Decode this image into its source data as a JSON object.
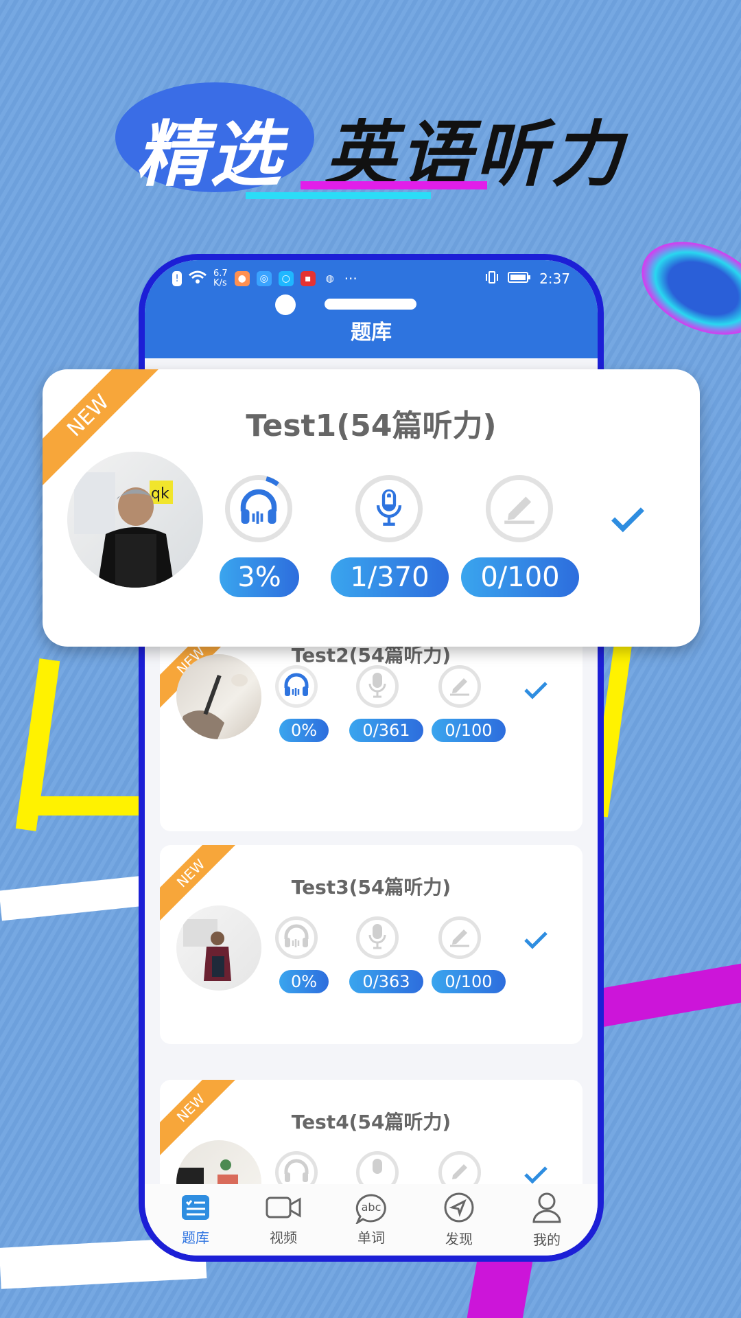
{
  "headline": {
    "left_text": "精选",
    "right_text": "英语听力"
  },
  "phone": {
    "status_bar": {
      "speed": "6.7",
      "speed_unit": "K/s",
      "more": "···",
      "time": "2:37"
    },
    "title": "题库"
  },
  "featured_card": {
    "badge": "NEW",
    "title": "Test1(54篇听力)",
    "stats": {
      "listen": "3%",
      "speak": "1/370",
      "write": "0/100"
    },
    "listen_progress": 0.03
  },
  "cards": [
    {
      "title": "Test2(54篇听力)",
      "badge": "NEW",
      "stats": {
        "listen": "0%",
        "speak": "0/361",
        "write": "0/100"
      }
    },
    {
      "title": "Test3(54篇听力)",
      "badge": "NEW",
      "stats": {
        "listen": "0%",
        "speak": "0/363",
        "write": "0/100"
      }
    },
    {
      "title": "Test4(54篇听力)",
      "badge": "NEW",
      "stats": {
        "listen": "",
        "speak": "",
        "write": ""
      }
    }
  ],
  "tabbar": {
    "items": [
      {
        "label": "题库",
        "icon": "question-bank-icon"
      },
      {
        "label": "视频",
        "icon": "video-icon"
      },
      {
        "label": "单词",
        "icon": "abc-icon",
        "icon_text": "abc"
      },
      {
        "label": "发现",
        "icon": "compass-icon"
      },
      {
        "label": "我的",
        "icon": "person-icon"
      }
    ]
  },
  "colors": {
    "background": "#6fa3e0",
    "accent": "#2e74df",
    "ribbon": "#f7a63a",
    "phone_frame": "#1c1fd6"
  }
}
